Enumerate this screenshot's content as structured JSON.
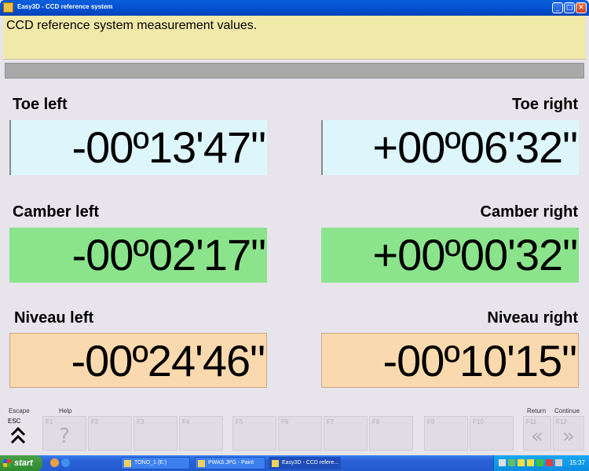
{
  "window": {
    "title": "Easy3D - CCD reference system",
    "min": "_",
    "max": "□",
    "close": "✕"
  },
  "message": "CCD reference system measurement values.",
  "measurements": {
    "toe_left": {
      "label": "Toe left",
      "value": "-00º13'47\""
    },
    "toe_right": {
      "label": "Toe right",
      "value": "+00º06'32\""
    },
    "camber_left": {
      "label": "Camber left",
      "value": "-00º02'17\""
    },
    "camber_right": {
      "label": "Camber right",
      "value": "+00º00'32\""
    },
    "niveau_left": {
      "label": "Niveau left",
      "value": "-00º24'46\""
    },
    "niveau_right": {
      "label": "Niveau right",
      "value": "-00º10'15\""
    }
  },
  "colors": {
    "toe": "#ddf6fb",
    "camber": "#8be48c",
    "niveau": "#fbd9ae",
    "message_bg": "#f1e9a9"
  },
  "fkeys": {
    "escape_label": "Escape",
    "help_label": "Help",
    "return_label": "Return",
    "continue_label": "Continue",
    "esc": "ESC",
    "esc_glyph": "⌃⌃",
    "f1": "F1",
    "f1_glyph": "?",
    "f2": "F2",
    "f3": "F3",
    "f4": "F4",
    "f5": "F5",
    "f6": "F6",
    "f7": "F7",
    "f8": "F8",
    "f9": "F9",
    "f10": "F10",
    "f11": "F11",
    "f11_glyph": "«",
    "f12": "F12",
    "f12_glyph": "»"
  },
  "taskbar": {
    "start": "start",
    "tasks": [
      "TONO_1 (E:)",
      "PWAS.JPG - Paint",
      "Easy3D - CCD refere..."
    ],
    "clock": "15:37"
  }
}
